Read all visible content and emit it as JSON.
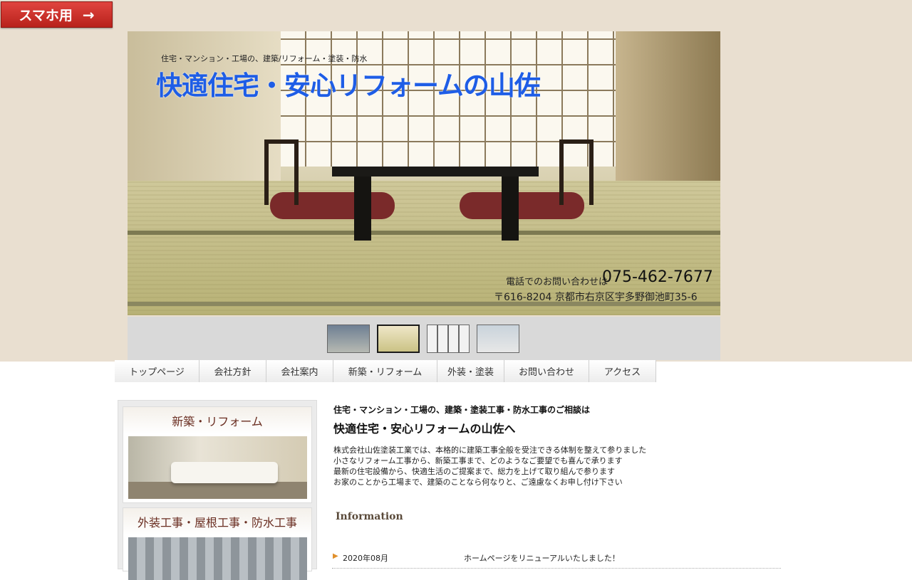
{
  "sp_button": {
    "label": "スマホ用",
    "arrow": "→"
  },
  "header": {
    "tagline": "住宅・マンション・工場の、建築/リフォーム・塗装・防水",
    "title": "快適住宅・安心リフォームの山佐",
    "phone_label": "電話でのお問い合わせは",
    "phone_number": "075-462-7677",
    "address": "〒616-8204 京都市右京区宇多野御池町35-6"
  },
  "nav": {
    "items": [
      "トップページ",
      "会社方針",
      "会社案内",
      "新築・リフォーム",
      "外装・塗装",
      "お問い合わせ",
      "アクセス"
    ]
  },
  "sidebar": {
    "cards": [
      {
        "title": "新築・リフォーム"
      },
      {
        "title": "外装工事・屋根工事・防水工事"
      }
    ]
  },
  "main": {
    "lead": "住宅・マンション・工場の、建築・塗装工事・防水工事のご相談は",
    "title": "快適住宅・安心リフォームの山佐へ",
    "lines": [
      "株式会社山佐塗装工業では、本格的に建築工事全般を受注できる体制を整えて参りました",
      "小さなリフォーム工事から、新築工事まで、どのようなご要望でも喜んで承ります",
      "最新の住宅設備から、快適生活のご提案まで、総力を上げて取り組んで参ります",
      "お家のことから工場まで、建築のことなら何なりと、ご遠慮なくお申し付け下さい"
    ]
  },
  "information": {
    "heading": "Information",
    "news": [
      {
        "date": "2020年08月",
        "text": "ホームページをリニューアルいたしました！"
      }
    ]
  },
  "colors": {
    "title_blue": "#1e5de6",
    "background_beige": "#e9dfd0",
    "sp_button_red": "#c8302a"
  }
}
